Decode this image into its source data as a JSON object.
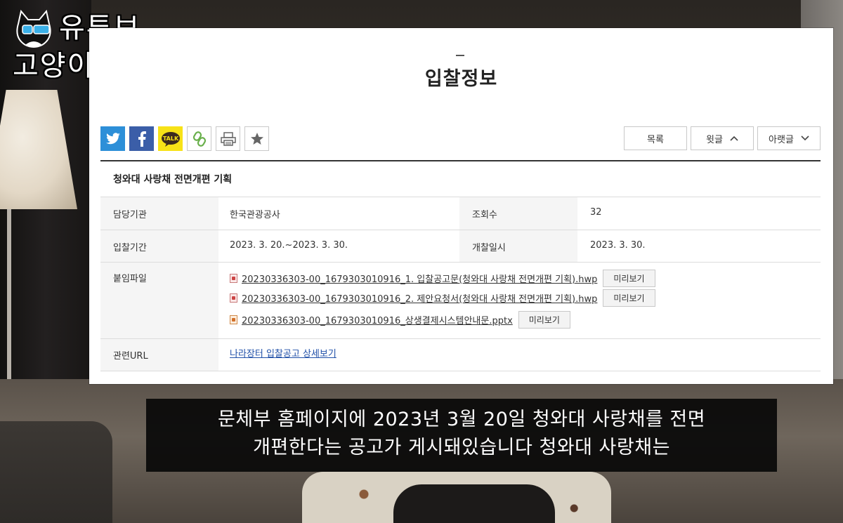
{
  "logo": {
    "line1": "유튜브",
    "line2": "고양이 뉴스"
  },
  "page": {
    "title": "입찰정보"
  },
  "share": {
    "kakao_label": "TALK"
  },
  "nav": {
    "list_label": "목록",
    "prev_label": "윗글",
    "next_label": "아랫글"
  },
  "post": {
    "subject": "청와대 사랑채 전면개편 기획",
    "org_label": "담당기관",
    "org_value": "한국관광공사",
    "views_label": "조회수",
    "views_value": "32",
    "period_label": "입찰기간",
    "period_value": "2023. 3. 20.~2023. 3. 30.",
    "opening_label": "개찰일시",
    "opening_value": "2023. 3. 30.",
    "files_label": "붙임파일",
    "files": [
      {
        "name": "20230336303-00_1679303010916_1. 입찰공고문(청와대 사랑채 전면개편 기획).hwp",
        "preview": "미리보기"
      },
      {
        "name": "20230336303-00_1679303010916_2. 제안요청서(청와대 사랑채 전면개편 기획).hwp",
        "preview": "미리보기"
      },
      {
        "name": "20230336303-00_1679303010916_상생결제시스템안내문.pptx",
        "preview": "미리보기"
      }
    ],
    "url_label": "관련URL",
    "url_value": "나라장터 입찰공고 상세보기"
  },
  "subtitle": {
    "line1": "문체부 홈페이지에 2023년 3월 20일 청와대 사랑채를 전면",
    "line2": "개편한다는 공고가 게시돼있습니다 청와대 사랑채는"
  },
  "colors": {
    "twitter": "#2d8fd8",
    "facebook": "#3b5ea8",
    "kakao": "#f7e217",
    "link": "#1f4fa8"
  }
}
